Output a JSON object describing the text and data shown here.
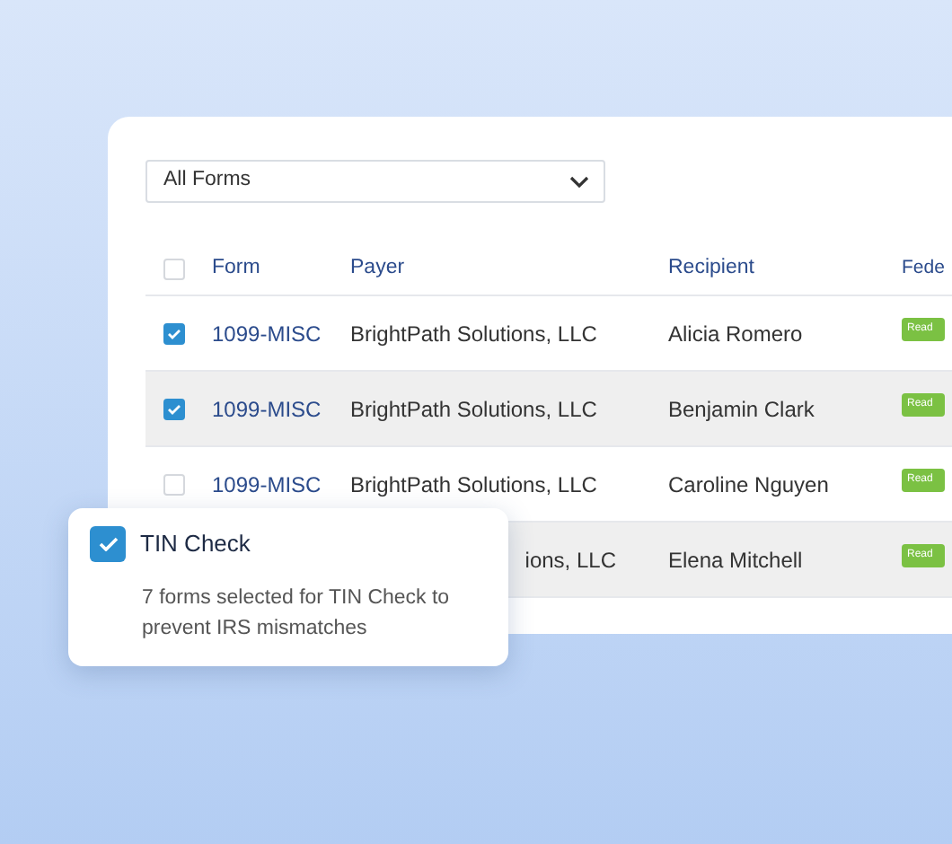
{
  "filter": {
    "value": "All Forms"
  },
  "table": {
    "select_all_checked": false,
    "columns": [
      "Form",
      "Payer",
      "Recipient",
      "Fede"
    ],
    "rows": [
      {
        "checked": true,
        "highlighted": false,
        "form": "1099-MISC",
        "payer": "BrightPath Solutions, LLC",
        "recipient": "Alicia Romero",
        "status": "Read"
      },
      {
        "checked": true,
        "highlighted": true,
        "form": "1099-MISC",
        "payer": "BrightPath Solutions, LLC",
        "recipient": "Benjamin Clark",
        "status": "Read"
      },
      {
        "checked": false,
        "highlighted": false,
        "form": "1099-MISC",
        "payer": "BrightPath Solutions, LLC",
        "recipient": "Caroline Nguyen",
        "status": "Read"
      },
      {
        "highlighted": true,
        "payer": "ions, LLC",
        "recipient": "Elena Mitchell",
        "status": "Read"
      }
    ]
  },
  "popup": {
    "checked": true,
    "title": "TIN Check",
    "text": "7 forms selected for TIN Check to prevent IRS mismatches"
  }
}
